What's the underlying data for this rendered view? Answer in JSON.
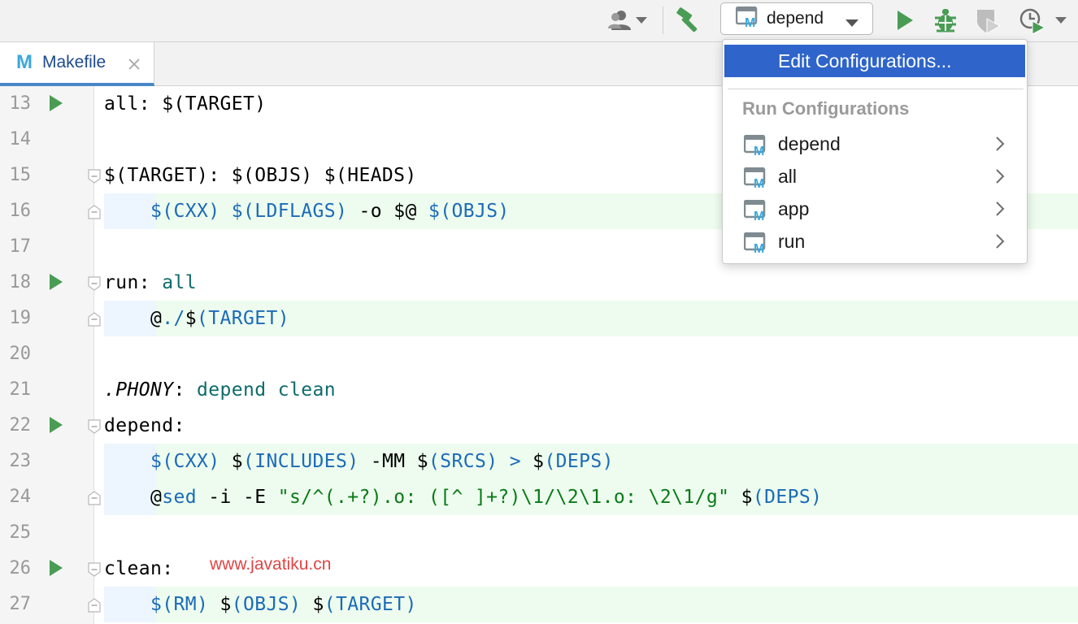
{
  "toolbar": {
    "run_config": "depend",
    "icons": [
      "user-icon",
      "chevron-down-icon",
      "hammer-icon",
      "makefile-icon",
      "run-icon",
      "debug-icon",
      "coverage-icon",
      "profiler-icon"
    ],
    "colors": {
      "run_green": "#499c54",
      "accent_blue": "#3da8d9"
    }
  },
  "tabs": [
    {
      "icon": "M",
      "label": "Makefile",
      "active": true
    }
  ],
  "editor": {
    "lines": [
      {
        "num": "13",
        "run": true,
        "fold": "",
        "hl": "",
        "segs": [
          [
            "all: $(TARGET)",
            ""
          ]
        ]
      },
      {
        "num": "14",
        "run": false,
        "fold": "",
        "hl": "",
        "segs": []
      },
      {
        "num": "15",
        "run": false,
        "fold": "start",
        "hl": "",
        "segs": [
          [
            "$(TARGET): $(OBJS) $(HEADS)",
            ""
          ]
        ]
      },
      {
        "num": "16",
        "run": false,
        "fold": "end",
        "hl": "block",
        "segs": [
          [
            "    ",
            ""
          ],
          [
            "$(CXX)",
            "v"
          ],
          [
            " ",
            ""
          ],
          [
            "$(LDFLAGS)",
            "v"
          ],
          [
            " -o $@ ",
            ""
          ],
          [
            "$(OBJS)",
            "v"
          ]
        ]
      },
      {
        "num": "17",
        "run": false,
        "fold": "",
        "hl": "",
        "segs": []
      },
      {
        "num": "18",
        "run": true,
        "fold": "start",
        "hl": "",
        "segs": [
          [
            "run: ",
            ""
          ],
          [
            "all",
            "t"
          ]
        ]
      },
      {
        "num": "19",
        "run": false,
        "fold": "end",
        "hl": "block",
        "segs": [
          [
            "    @",
            ""
          ],
          [
            "./",
            "v"
          ],
          [
            "$",
            ""
          ],
          [
            "(TARGET)",
            "v"
          ]
        ]
      },
      {
        "num": "20",
        "run": false,
        "fold": "",
        "hl": "",
        "segs": []
      },
      {
        "num": "21",
        "run": false,
        "fold": "",
        "hl": "",
        "segs": [
          [
            ".PHONY",
            "it"
          ],
          [
            ": ",
            ""
          ],
          [
            "depend clean",
            "t"
          ]
        ]
      },
      {
        "num": "22",
        "run": true,
        "fold": "start",
        "hl": "",
        "segs": [
          [
            "depend:",
            ""
          ]
        ]
      },
      {
        "num": "23",
        "run": false,
        "fold": "",
        "hl": "block",
        "segs": [
          [
            "    ",
            ""
          ],
          [
            "$(CXX)",
            "v"
          ],
          [
            " $",
            ""
          ],
          [
            "(INCLUDES)",
            "v"
          ],
          [
            " -MM $",
            ""
          ],
          [
            "(SRCS)",
            "v"
          ],
          [
            " ",
            ""
          ],
          [
            ">",
            "v"
          ],
          [
            " $",
            ""
          ],
          [
            "(DEPS)",
            "v"
          ]
        ]
      },
      {
        "num": "24",
        "run": false,
        "fold": "end",
        "hl": "block",
        "segs": [
          [
            "    @",
            ""
          ],
          [
            "sed",
            "v"
          ],
          [
            " -i -E ",
            ""
          ],
          [
            "\"s/^(.+?).o: ([^ ]+?)\\1/\\2\\1.o: \\2\\1/g\"",
            "g"
          ],
          [
            " $",
            ""
          ],
          [
            "(DEPS)",
            "v"
          ]
        ]
      },
      {
        "num": "25",
        "run": false,
        "fold": "",
        "hl": "",
        "segs": []
      },
      {
        "num": "26",
        "run": true,
        "fold": "start",
        "hl": "",
        "segs": [
          [
            "clean:",
            ""
          ]
        ]
      },
      {
        "num": "27",
        "run": false,
        "fold": "end",
        "hl": "block",
        "segs": [
          [
            "    ",
            ""
          ],
          [
            "$(RM)",
            "v"
          ],
          [
            " $",
            ""
          ],
          [
            "(OBJS)",
            "v"
          ],
          [
            " $",
            ""
          ],
          [
            "(TARGET)",
            "v"
          ]
        ]
      }
    ]
  },
  "watermark": "www.javatiku.cn",
  "dropdown": {
    "edit_label": "Edit Configurations...",
    "section_header": "Run Configurations",
    "items": [
      {
        "label": "depend"
      },
      {
        "label": "all"
      },
      {
        "label": "app"
      },
      {
        "label": "run"
      }
    ]
  }
}
